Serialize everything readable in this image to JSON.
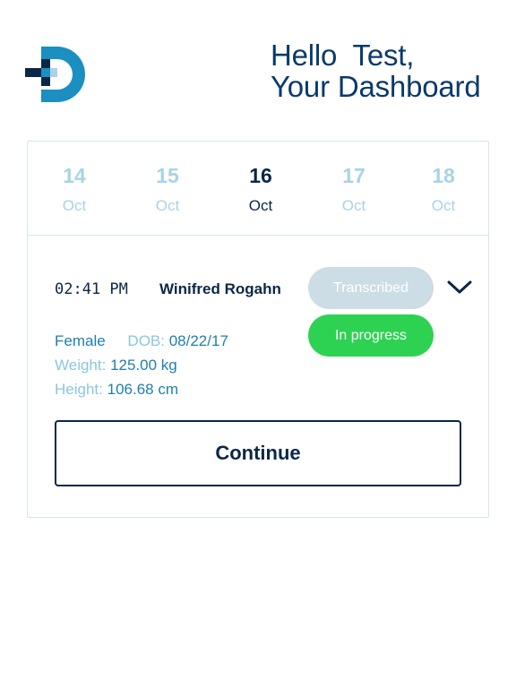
{
  "header": {
    "greeting_line1": "Hello  Test,",
    "greeting_line2": "Your Dashboard",
    "logo_icon": "dashboard-d-logo",
    "colors": {
      "dark_navy": "#0b2746",
      "heading_blue": "#0b3a6b",
      "logo_blue": "#1b8fc0"
    }
  },
  "dates": [
    {
      "day": "14",
      "month": "Oct",
      "active": false
    },
    {
      "day": "15",
      "month": "Oct",
      "active": false
    },
    {
      "day": "16",
      "month": "Oct",
      "active": true
    },
    {
      "day": "17",
      "month": "Oct",
      "active": false
    },
    {
      "day": "18",
      "month": "Oct",
      "active": false
    }
  ],
  "appointment": {
    "time": "02:41 PM",
    "patient_name": "Winifred Rogahn",
    "gender": "Female",
    "dob_label": "DOB:",
    "dob": "08/22/17",
    "weight_label": "Weight:",
    "weight": "125.00 kg",
    "height_label": "Height:",
    "height": "106.68 cm",
    "status_transcribed": "Transcribed",
    "status_in_progress": "In progress",
    "expand_icon": "chevron-down-icon",
    "continue_label": "Continue",
    "colors": {
      "transcribed": "#ccdde6",
      "in_progress": "#2ed252"
    }
  }
}
